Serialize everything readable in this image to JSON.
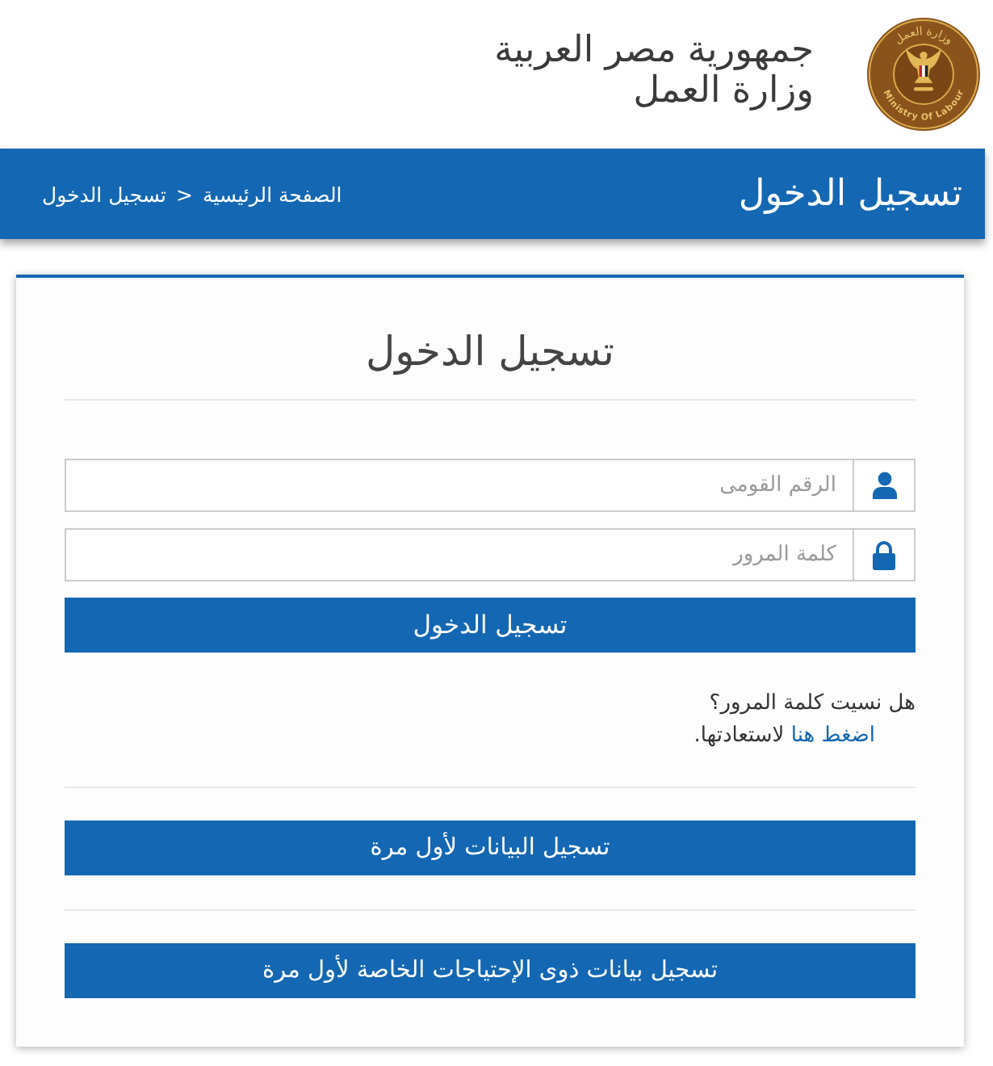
{
  "header": {
    "logo": {
      "top_text": "وزارة العمل",
      "bottom_text": "Ministry Of Labour"
    },
    "title_lines": [
      "جمهورية مصر العربية",
      "وزارة العمل"
    ]
  },
  "page_bar": {
    "title": "تسجيل الدخول",
    "breadcrumb": [
      {
        "label": "الصفحة الرئيسية",
        "kind": "link"
      },
      {
        "label": ">",
        "kind": "separator"
      },
      {
        "label": "تسجيل الدخول",
        "kind": "current"
      }
    ]
  },
  "login_card": {
    "title": "تسجيل الدخول",
    "fields": [
      {
        "kind": "user",
        "placeholder": "الرقم القومى"
      },
      {
        "kind": "lock",
        "placeholder": "كلمة المرور"
      }
    ],
    "submit": "تسجيل الدخول",
    "forgot": {
      "question": "هل نسيت كلمة المرور؟",
      "link": "اضغط هنا",
      "rest": "لاستعادتها."
    },
    "register_buttons": [
      "تسجيل البيانات لأول مرة",
      "تسجيل بيانات ذوى الإحتياجات الخاصة لأول مرة"
    ]
  }
}
